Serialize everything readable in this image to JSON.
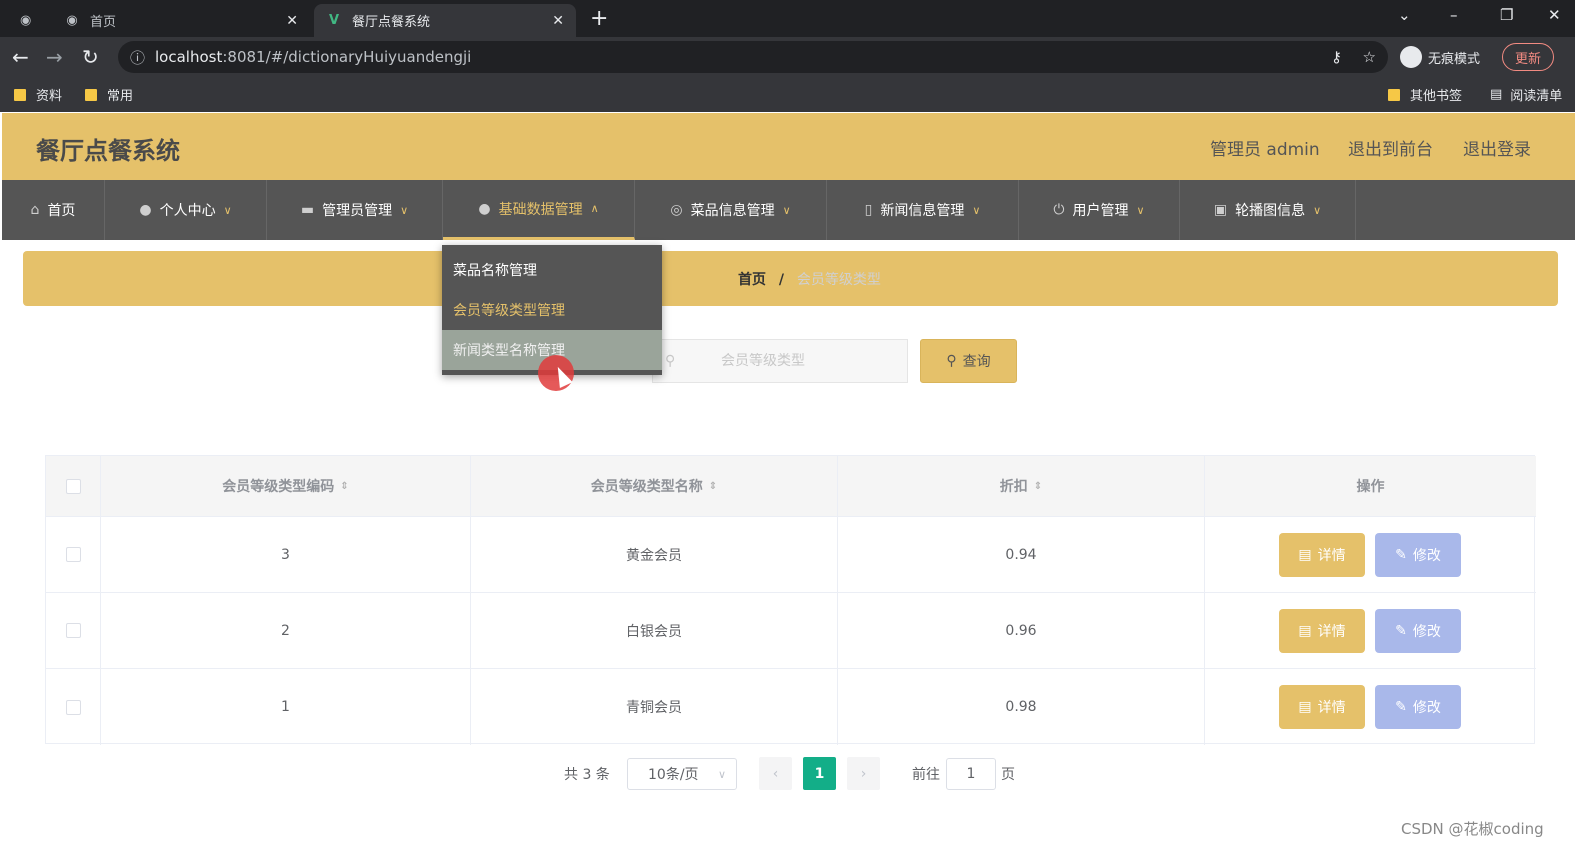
{
  "browser": {
    "tabs": [
      {
        "label": "首页",
        "active": false
      },
      {
        "label": "餐厅点餐系统",
        "active": true
      }
    ],
    "url_host": "localhost",
    "url_rest": ":8081/#/dictionaryHuiyuandengji",
    "incognito_label": "无痕模式",
    "update_label": "更新",
    "bookmarks": [
      "资料",
      "常用"
    ],
    "other_bookmarks": "其他书签",
    "reading_list": "阅读清单"
  },
  "header": {
    "title": "餐厅点餐系统",
    "user": "管理员 admin",
    "to_front": "退出到前台",
    "logout": "退出登录"
  },
  "nav": {
    "items": [
      {
        "label": "首页",
        "icon": "home-icon"
      },
      {
        "label": "个人中心",
        "icon": "user-icon"
      },
      {
        "label": "管理员管理",
        "icon": "briefcase-icon"
      },
      {
        "label": "基础数据管理",
        "icon": "user-icon"
      },
      {
        "label": "菜品信息管理",
        "icon": "compass-icon"
      },
      {
        "label": "新闻信息管理",
        "icon": "phone-icon"
      },
      {
        "label": "用户管理",
        "icon": "power-icon"
      },
      {
        "label": "轮播图信息",
        "icon": "chart-icon"
      }
    ]
  },
  "dropdown": {
    "items": [
      "菜品名称管理",
      "会员等级类型管理",
      "新闻类型名称管理"
    ]
  },
  "breadcrumb": {
    "home": "首页",
    "sep": "/",
    "current": "会员等级类型"
  },
  "search": {
    "placeholder": "会员等级类型",
    "button": "查询"
  },
  "table": {
    "columns": [
      "会员等级类型编码",
      "会员等级类型名称",
      "折扣",
      "操作"
    ],
    "rows": [
      {
        "code": "3",
        "name": "黄金会员",
        "discount": "0.94"
      },
      {
        "code": "2",
        "name": "白银会员",
        "discount": "0.96"
      },
      {
        "code": "1",
        "name": "青铜会员",
        "discount": "0.98"
      }
    ],
    "detail_label": "详情",
    "edit_label": "修改"
  },
  "pagination": {
    "total": "共 3 条",
    "page_size": "10条/页",
    "current_page": "1",
    "goto_prefix": "前往",
    "goto_value": "1",
    "goto_suffix": "页"
  },
  "watermark": "CSDN @花椒coding",
  "colors": {
    "accent": "#e5c16a",
    "nav_bg": "#555555",
    "edit_btn": "#a9b8ea",
    "page_active": "#13ae88"
  }
}
